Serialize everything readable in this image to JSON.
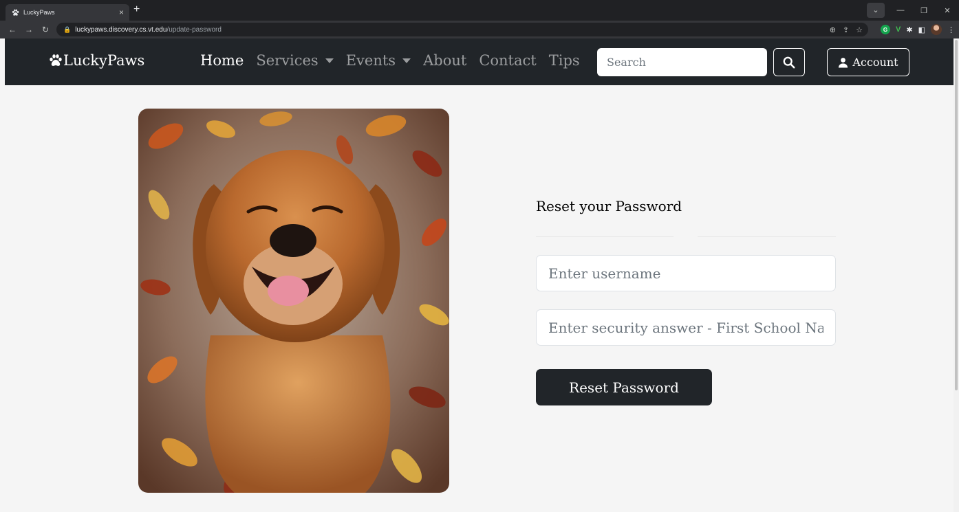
{
  "browser": {
    "tab_title": "LuckyPaws",
    "tab_close": "×",
    "new_tab": "+",
    "url_host": "luckypaws.discovery.cs.vt.edu",
    "url_path": "/update-password"
  },
  "navbar": {
    "brand": "LuckyPaws",
    "links": {
      "home": "Home",
      "services": "Services",
      "events": "Events",
      "about": "About",
      "contact": "Contact",
      "tips": "Tips"
    },
    "search_placeholder": "Search",
    "account_label": "Account"
  },
  "form": {
    "heading": "Reset your Password",
    "username_placeholder": "Enter username",
    "security_placeholder": "Enter security answer - First School Name",
    "submit_label": "Reset Password"
  },
  "colors": {
    "navbar_bg": "#212529",
    "page_bg": "#f5f5f5",
    "button_bg": "#212529"
  }
}
